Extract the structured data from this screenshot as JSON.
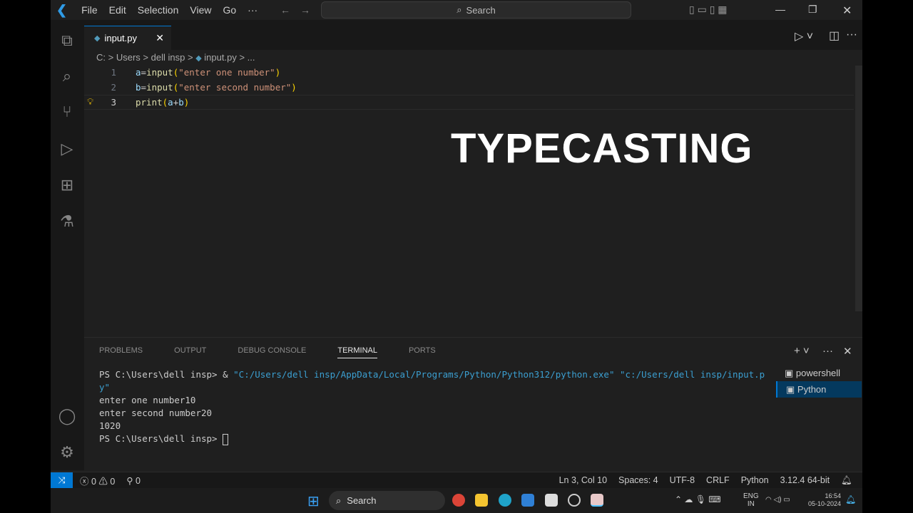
{
  "menu": [
    "File",
    "Edit",
    "Selection",
    "View",
    "Go",
    "···"
  ],
  "search_label": "Search",
  "tab": {
    "label": "input.py",
    "close": "✕"
  },
  "breadcrumb": [
    "C:",
    ">",
    "Users",
    ">",
    "dell insp",
    ">",
    "input.py",
    ">",
    "..."
  ],
  "code": [
    {
      "n": "1",
      "parts": [
        [
          "v",
          "a"
        ],
        [
          "",
          "="
        ],
        [
          "f",
          "input"
        ],
        [
          "p",
          "("
        ],
        [
          "s",
          "\"enter one number\""
        ],
        [
          "p",
          ")"
        ]
      ]
    },
    {
      "n": "2",
      "parts": [
        [
          "v",
          "b"
        ],
        [
          "",
          "="
        ],
        [
          "f",
          "input"
        ],
        [
          "p",
          "("
        ],
        [
          "s",
          "\"enter second number\""
        ],
        [
          "p",
          ")"
        ]
      ]
    },
    {
      "n": "3",
      "parts": [
        [
          "f",
          "print"
        ],
        [
          "p",
          "("
        ],
        [
          "v",
          "a"
        ],
        [
          "",
          "+"
        ],
        [
          "v",
          "b"
        ],
        [
          "p",
          ")"
        ]
      ]
    }
  ],
  "overlay_title": "TYPECASTING",
  "panel": {
    "tabs": [
      "PROBLEMS",
      "OUTPUT",
      "DEBUG CONSOLE",
      "TERMINAL",
      "PORTS"
    ],
    "active": "TERMINAL"
  },
  "terminal": {
    "prompt1": "PS C:\\Users\\dell insp> & ",
    "cmd": "\"C:/Users/dell insp/AppData/Local/Programs/Python/Python312/python.exe\" \"c:/Users/dell insp/input.py\"",
    "out1": "enter one number10",
    "out2": "enter second number20",
    "out3": "1020",
    "prompt2": "PS C:\\Users\\dell insp> "
  },
  "terminals": [
    "powershell",
    "Python"
  ],
  "status": {
    "errors": "0",
    "warnings": "0",
    "ports": "0",
    "position": "Ln 3, Col 10",
    "spaces": "Spaces: 4",
    "encoding": "UTF-8",
    "eol": "CRLF",
    "language": "Python",
    "interpreter": "3.12.4 64-bit"
  },
  "taskbar": {
    "search": "Search",
    "lang1": "ENG",
    "lang2": "IN",
    "time": "16:54",
    "date": "05-10-2024"
  }
}
